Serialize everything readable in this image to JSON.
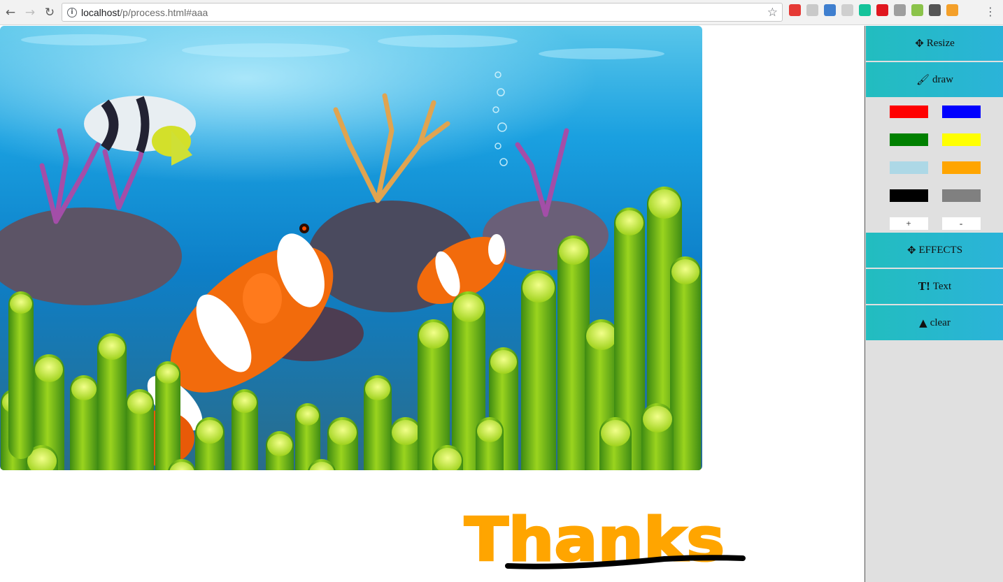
{
  "browser": {
    "url_host": "localhost",
    "url_path": "/p/process.html#aaa",
    "extensions": [
      {
        "name": "chrome-ext-icon",
        "color": "#e53935"
      },
      {
        "name": "puzzle-ext-icon",
        "color": "#c9c9c9"
      },
      {
        "name": "globe-ext-icon",
        "color": "#3f7fcf"
      },
      {
        "name": "shield-ext-icon",
        "color": "#cfcfcf"
      },
      {
        "name": "grammarly-ext-icon",
        "color": "#15c39a"
      },
      {
        "name": "opera-ext-icon",
        "color": "#e0161e"
      },
      {
        "name": "react-ext-icon",
        "color": "#9e9e9e"
      },
      {
        "name": "js-ext-icon",
        "color": "#8bc34a"
      },
      {
        "name": "film-ext-icon",
        "color": "#555555"
      },
      {
        "name": "orange-ext-icon",
        "color": "#f4a02a"
      }
    ]
  },
  "sidebar": {
    "resize_label": "Resize",
    "draw_label": "draw",
    "effects_label": "EFFECTS",
    "text_label": "Text",
    "text_icon": "T!",
    "clear_label": "clear",
    "colors": [
      "#ff0000",
      "#0000ff",
      "#008000",
      "#ffff00",
      "#add8e6",
      "#ffa500",
      "#000000",
      "#808080"
    ],
    "plus_label": "+",
    "minus_label": "-"
  },
  "canvas": {
    "handwriting": "Thanks",
    "stroke_colors": {
      "text": "#ffa500",
      "underline": "#000000"
    }
  }
}
